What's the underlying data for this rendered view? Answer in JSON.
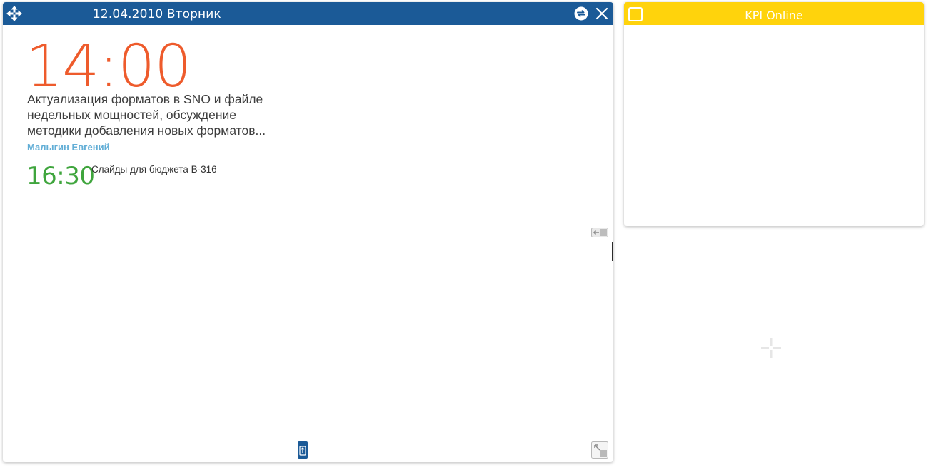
{
  "calendar": {
    "date_label": "12.04.2010 Вторник",
    "header_color": "#1b5a97",
    "events": [
      {
        "time": "14:00",
        "title": "Актуализация форматов в SNO и файле недельных мощностей, обсуждение методики добавления новых форматов...",
        "author": "Малыгин Евгений",
        "time_color": "#ee5b2c"
      },
      {
        "time": "16:30",
        "title": "Слайды для бюджета В-316",
        "time_color": "#3fa53d"
      }
    ],
    "icons": {
      "move": "move-arrows-icon",
      "refresh": "refresh-icon",
      "close": "close-icon",
      "side_toggle": "collapse-arrow-icon",
      "bottom": "upload-arrow-icon",
      "resize": "resize-corner-icon"
    }
  },
  "kpi": {
    "title": "KPI Online",
    "header_color": "#ffd30c"
  },
  "add_widget": {
    "icon": "plus-icon"
  }
}
